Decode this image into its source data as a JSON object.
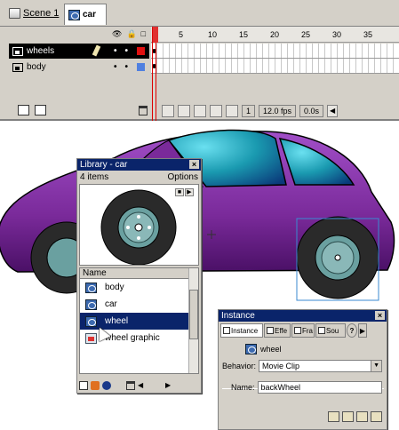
{
  "scene_bar": {
    "scene_label": "Scene 1",
    "symbol_tab": "car"
  },
  "timeline": {
    "layers": [
      {
        "name": "wheels",
        "selected": true,
        "color": "#e01010"
      },
      {
        "name": "body",
        "selected": false,
        "color": "#5080e0"
      }
    ],
    "ruler_ticks": [
      "1",
      "5",
      "10",
      "15",
      "20",
      "25",
      "30",
      "35"
    ],
    "current_frame": "1",
    "frame_rate": "12.0 fps",
    "elapsed": "0.0s"
  },
  "library": {
    "title": "Library - car",
    "count": "4 items",
    "options": "Options",
    "column_name": "Name",
    "items": [
      {
        "label": "body",
        "icon": "movie-clip-icon"
      },
      {
        "label": "car",
        "icon": "movie-clip-icon"
      },
      {
        "label": "wheel",
        "icon": "movie-clip-icon",
        "selected": true
      },
      {
        "label": "wheel graphic",
        "icon": "graphic-icon"
      }
    ]
  },
  "instance": {
    "title": "Instance",
    "tabs": [
      "Instance",
      "Effe",
      "Fra",
      "Sou",
      "?"
    ],
    "symbol_name": "wheel",
    "behavior_label": "Behavior:",
    "behavior_value": "Movie Clip",
    "name_label": "Name:",
    "name_value": "backWheel"
  },
  "colors": {
    "car_body": "#7a2a9a",
    "window": "#1a9ab0",
    "tire": "#2a2a2a",
    "hub": "#6aa0a0",
    "selection": "#0a246a"
  }
}
